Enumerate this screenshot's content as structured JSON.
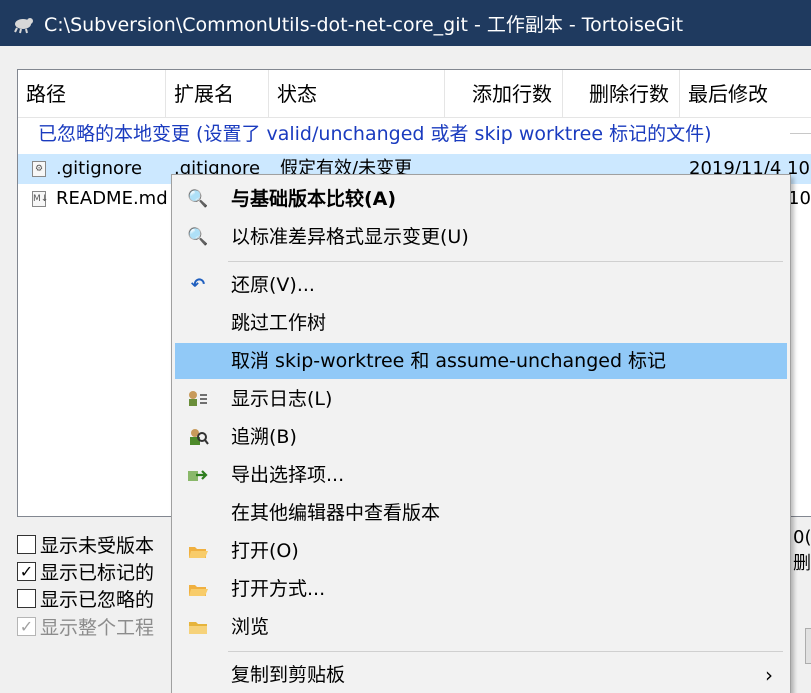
{
  "window": {
    "title": "C:\\Subversion\\CommonUtils-dot-net-core_git - 工作副本 - TortoiseGit"
  },
  "list": {
    "columns": [
      "路径",
      "扩展名",
      "状态",
      "添加行数",
      "删除行数",
      "最后修改"
    ],
    "group_label": "已忽略的本地变更 (设置了 valid/unchanged 或者 skip worktree 标记的文件)",
    "rows": [
      {
        "path": ".gitignore",
        "ext": ".gitignore",
        "status": "假定有效/未变更",
        "modified": "2019/11/4 10:",
        "selected": true,
        "icon": "settings-file-icon"
      },
      {
        "path": "README.md",
        "ext": "",
        "status": "",
        "modified": "10:",
        "selected": false,
        "icon": "markdown-file-icon"
      }
    ]
  },
  "checkboxes": [
    {
      "label": "显示未受版本",
      "checked": false,
      "disabled": false
    },
    {
      "label": "显示已标记的",
      "checked": true,
      "disabled": false
    },
    {
      "label": "显示已忽略的",
      "checked": false,
      "disabled": false
    },
    {
      "label": "显示整个工程",
      "checked": true,
      "disabled": true
    }
  ],
  "right_fragments": {
    "count": "0(",
    "delete": "删"
  },
  "menu": {
    "items": [
      {
        "label": "与基础版本比较(A)",
        "icon": "diff-magnifier-icon",
        "bold": true,
        "highlight": false
      },
      {
        "label": "以标准差异格式显示变更(U)",
        "icon": "diff-unified-icon",
        "bold": false,
        "highlight": false
      },
      {
        "label": "还原(V)...",
        "icon": "revert-icon",
        "bold": false,
        "highlight": false
      },
      {
        "label": "跳过工作树",
        "icon": "",
        "bold": false,
        "highlight": false
      },
      {
        "label": "取消 skip-worktree 和 assume-unchanged 标记",
        "icon": "",
        "bold": false,
        "highlight": true
      },
      {
        "label": "显示日志(L)",
        "icon": "show-log-icon",
        "bold": false,
        "highlight": false
      },
      {
        "label": "追溯(B)",
        "icon": "blame-icon",
        "bold": false,
        "highlight": false
      },
      {
        "label": "导出选择项...",
        "icon": "export-icon",
        "bold": false,
        "highlight": false
      },
      {
        "label": "在其他编辑器中查看版本",
        "icon": "",
        "bold": false,
        "highlight": false
      },
      {
        "label": "打开(O)",
        "icon": "open-folder-icon",
        "bold": false,
        "highlight": false
      },
      {
        "label": "打开方式...",
        "icon": "open-with-icon",
        "bold": false,
        "highlight": false
      },
      {
        "label": "浏览",
        "icon": "explore-folder-icon",
        "bold": false,
        "highlight": false
      },
      {
        "label": "复制到剪贴板",
        "icon": "",
        "bold": false,
        "highlight": false,
        "submenu_arrow": "›"
      }
    ]
  },
  "colors": {
    "titlebar": "#1f3a5f",
    "selection": "#cce8ff",
    "menu_highlight": "#91c9f7",
    "group_text": "#1a3bbf"
  }
}
